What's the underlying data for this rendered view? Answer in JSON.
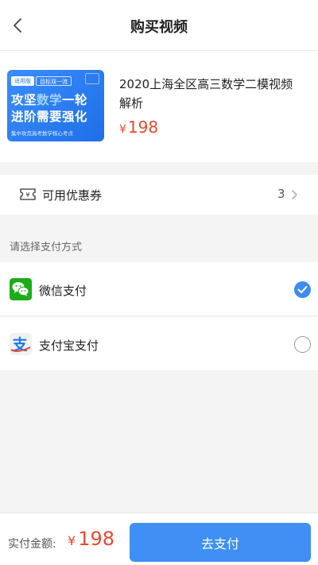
{
  "header": {
    "title": "购买视频"
  },
  "product": {
    "thumbnail": {
      "tag_a": "适用版",
      "tag_b": "目标双一流",
      "line1_a": "攻坚",
      "line1_hl": "数学",
      "line1_b": "一轮",
      "line2": "进阶需要强化",
      "sub": "集中攻克高考数学核心考点"
    },
    "name": "2020上海全区高三数学二模视频解析",
    "currency": "¥",
    "price": "198"
  },
  "coupon": {
    "label": "可用优惠券",
    "count": "3"
  },
  "payment": {
    "section_title": "请选择支付方式",
    "methods": [
      {
        "label": "微信支付",
        "selected": true
      },
      {
        "label": "支付宝支付",
        "selected": false
      }
    ]
  },
  "footer": {
    "paid_label": "实付金额:",
    "currency": "¥",
    "amount": "198",
    "pay_button": "去支付"
  },
  "colors": {
    "accent": "#3f8ff4",
    "price": "#e8492f",
    "wechat": "#1aad19",
    "alipay": "#1677ff"
  }
}
